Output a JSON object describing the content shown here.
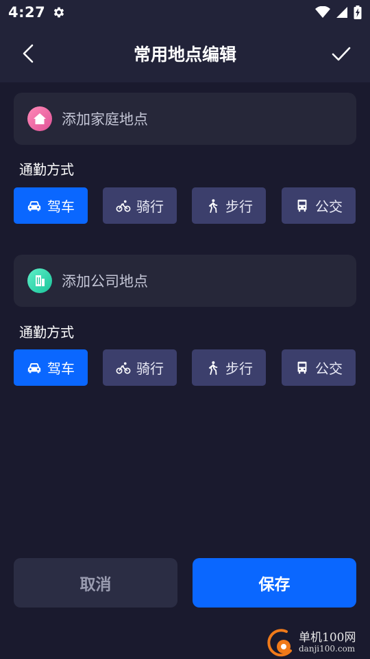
{
  "status_bar": {
    "time": "4:27"
  },
  "header": {
    "title": "常用地点编辑"
  },
  "home": {
    "label": "添加家庭地点",
    "commute_label": "通勤方式",
    "modes": [
      {
        "label": "驾车",
        "icon": "car-icon",
        "active": true
      },
      {
        "label": "骑行",
        "icon": "bike-icon",
        "active": false
      },
      {
        "label": "步行",
        "icon": "walk-icon",
        "active": false
      },
      {
        "label": "公交",
        "icon": "bus-icon",
        "active": false
      }
    ]
  },
  "work": {
    "label": "添加公司地点",
    "commute_label": "通勤方式",
    "modes": [
      {
        "label": "驾车",
        "icon": "car-icon",
        "active": true
      },
      {
        "label": "骑行",
        "icon": "bike-icon",
        "active": false
      },
      {
        "label": "步行",
        "icon": "walk-icon",
        "active": false
      },
      {
        "label": "公交",
        "icon": "bus-icon",
        "active": false
      }
    ]
  },
  "actions": {
    "cancel": "取消",
    "save": "保存"
  },
  "watermark": {
    "line1": "单机100网",
    "line2": "danji100.com"
  },
  "colors": {
    "background": "#1a1a2e",
    "header": "#222339",
    "card": "#262739",
    "mode_inactive": "#3c3f6c",
    "accent": "#0a67ff"
  }
}
